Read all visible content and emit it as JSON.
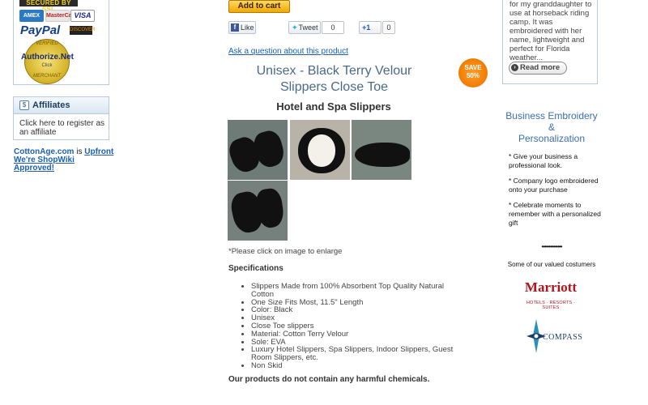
{
  "left": {
    "payment": {
      "ssl": "SECURED BY SSL",
      "amex": "AMEX",
      "mastercard": "MasterCard",
      "visa": "VISA",
      "paypal": "PayPal",
      "discover": "DISCOVER",
      "seal_top": "VERIFIED",
      "seal_name": "Authorize.Net",
      "seal_click": "Click",
      "seal_bottom": "MERCHANT"
    },
    "affiliates": {
      "title": "Affiliates",
      "text": "Click here to register as an affiliate"
    },
    "cottonage": {
      "site": "CottonAge.com",
      "is": " is ",
      "upfront": "Upfront",
      "approved": "We're ShopWiki Approved!"
    }
  },
  "center": {
    "add_to_cart": "Add to cart",
    "social": {
      "like": "Like",
      "tweet": "Tweet",
      "tweet_count": "0",
      "gplus": "+1",
      "gplus_count": "0"
    },
    "ask_link": "Ask a question about this product",
    "product_title": "Unisex - Black Terry Velour Slippers Close Toe",
    "save_badge": "SAVE 50%",
    "subtitle": "Hotel and Spa Slippers",
    "click_hint": "*Please click on image to enlarge",
    "specs_heading": "Specifications",
    "specs": [
      "Slippers Made from 100% Absorbent Top Quality Natural Cotton",
      "One Size Fits Most, 11.5\" Length",
      "Color: Black",
      "Unisex",
      "Close Toe slippers",
      "Material: Cotton Terry Velour",
      "Sole: EVA",
      "Luxury Hotel Slippers, Spa Slippers, Indoor Slippers, Guest Room Slippers, etc.",
      "Non Skid"
    ],
    "no_chemicals": "Our products do not contain any harmful chemicals."
  },
  "right": {
    "review": "for my granddaughter to use at horseback riding camp. It was embroidered with her name, lightweight and perfect for Florida weather...",
    "read_more": "Read more",
    "biz_title_1": "Business Embroidery",
    "biz_amp": "&",
    "biz_title_2": "Personalization",
    "bullets": [
      "* Give your business a professional look.",
      "* Company logo embroidered onto your purchase",
      "* Celebrate moments to remember with a personalized gift"
    ],
    "dots": "••••••••••••••",
    "valued": "Some of our valued costumers",
    "marriott": "Marriott",
    "marriott_sub": "HOTELS · RESORTS · SUITES",
    "compass": "COMPASS"
  },
  "colors": {
    "link": "#1a5fb4",
    "title": "#4a6a8a",
    "accent_orange": "#f07c00",
    "marriott_red": "#b3141c"
  }
}
